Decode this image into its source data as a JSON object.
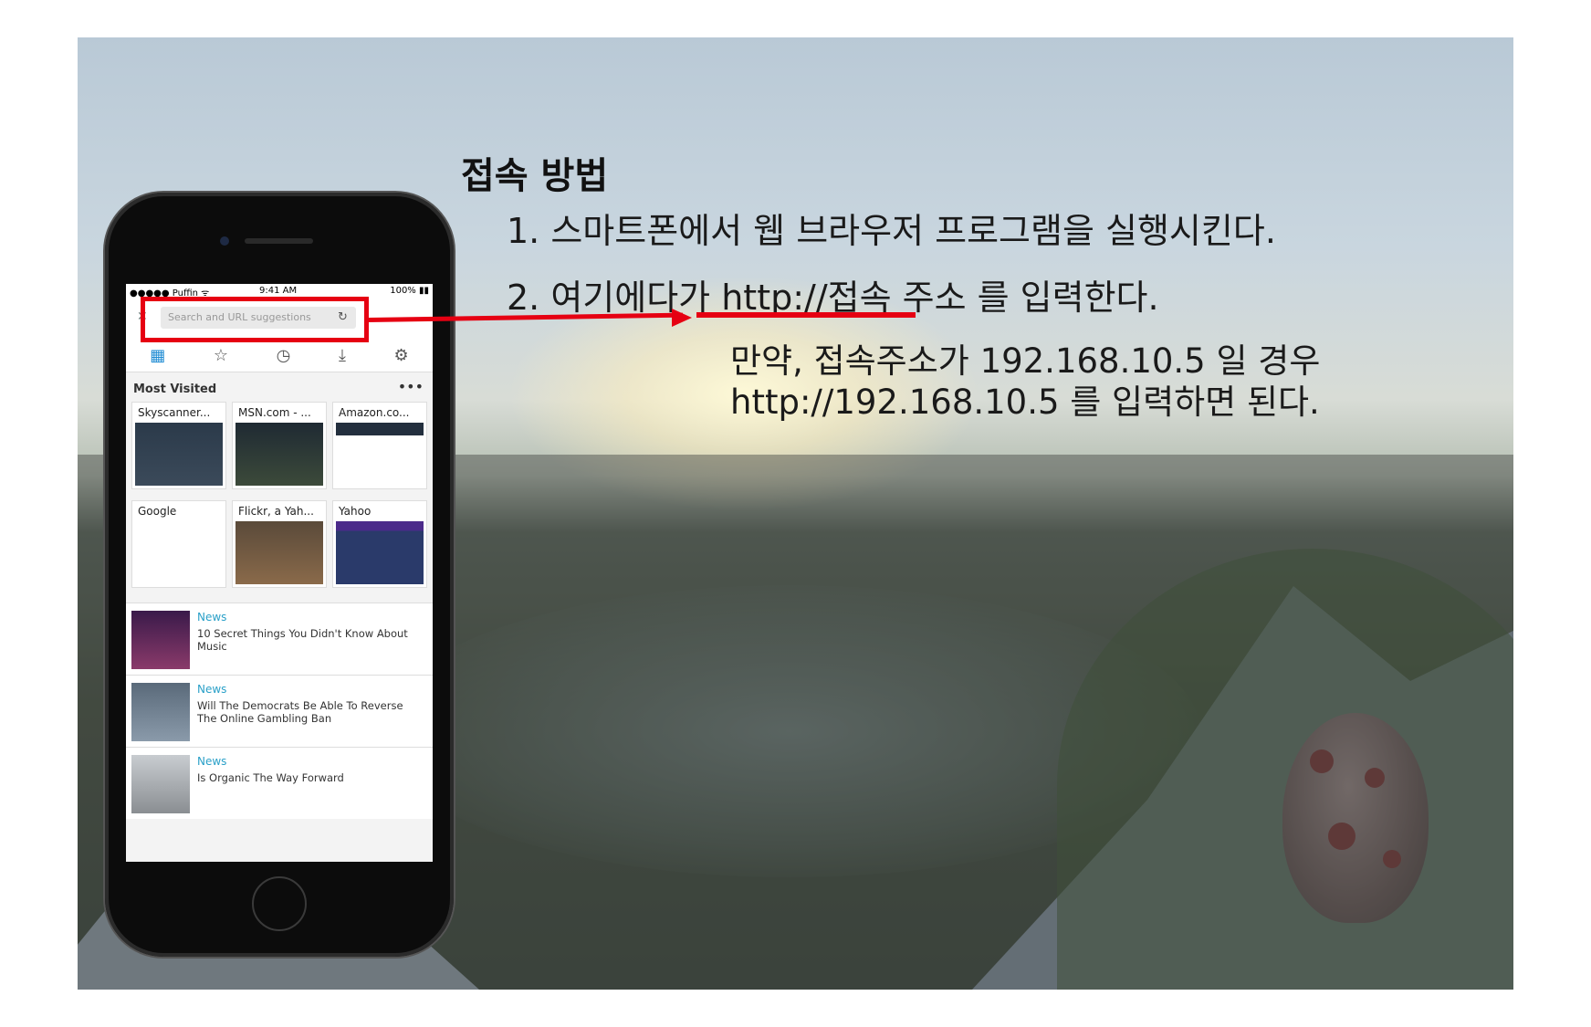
{
  "slide": {
    "title": "접속 방법",
    "step1": "1. 스마트폰에서 웹 브라우저 프로그램을 실행시킨다.",
    "step2": "2. 여기에다가 http://접속 주소  를 입력한다.",
    "note_line1": "만약, 접속주소가 192.168.10.5 일 경우",
    "note_line2": "http://192.168.10.5 를 입력하면 된다.",
    "accent_color": "#e60012"
  },
  "phone": {
    "status": {
      "carrier": "●●●●● Puffin ᯤ",
      "time": "9:41 AM",
      "battery": "100% ▮▮"
    },
    "url_placeholder": "Search and URL suggestions",
    "toolbar_icons": [
      "grid-icon",
      "star-icon",
      "clock-icon",
      "download-icon",
      "gear-icon"
    ],
    "most_visited_label": "Most Visited",
    "tiles": [
      {
        "title": "Skyscanner..."
      },
      {
        "title": "MSN.com - ..."
      },
      {
        "title": "Amazon.co..."
      },
      {
        "title": "Google"
      },
      {
        "title": "Flickr, a Yah..."
      },
      {
        "title": "Yahoo"
      }
    ],
    "news": [
      {
        "category": "News",
        "headline": "10 Secret Things You Didn't Know About Music"
      },
      {
        "category": "News",
        "headline": "Will The Democrats Be Able To Reverse The Online Gambling Ban"
      },
      {
        "category": "News",
        "headline": "Is Organic The Way Forward"
      }
    ]
  }
}
